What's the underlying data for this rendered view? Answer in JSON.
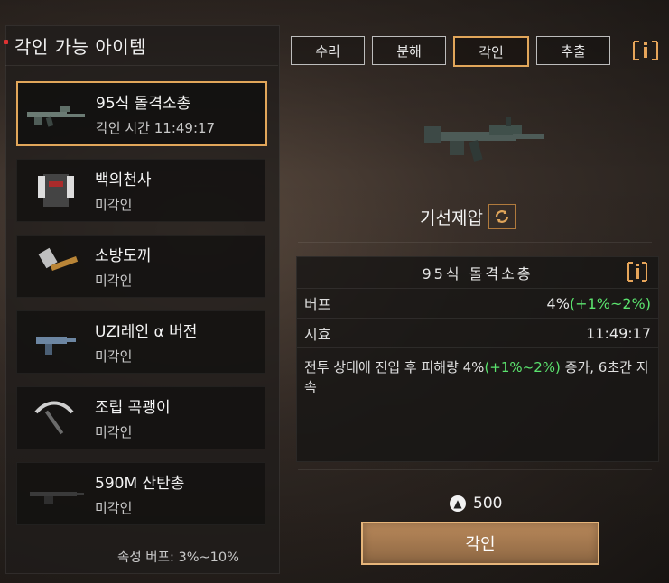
{
  "header": {
    "title": "각인 가능 아이템"
  },
  "left": {
    "items": [
      {
        "name": "95식 돌격소총",
        "sub": "각인 시간 11:49:17",
        "icon": "rifle-icon",
        "selected": true
      },
      {
        "name": "백의천사",
        "sub": "미각인",
        "icon": "vest-icon",
        "selected": false
      },
      {
        "name": "소방도끼",
        "sub": "미각인",
        "icon": "axe-icon",
        "selected": false
      },
      {
        "name": "UZI레인 α 버전",
        "sub": "미각인",
        "icon": "smg-icon",
        "selected": false
      },
      {
        "name": "조립 곡괭이",
        "sub": "미각인",
        "icon": "pickaxe-icon",
        "selected": false
      },
      {
        "name": "590M 산탄총",
        "sub": "미각인",
        "icon": "shotgun-icon",
        "selected": false
      }
    ],
    "attribute_text": "속성 버프: 3%~10%"
  },
  "tabs": [
    "수리",
    "분해",
    "각인",
    "추출"
  ],
  "active_tab": "각인",
  "engrave": {
    "name": "기선제압"
  },
  "stats": {
    "header": "95식 돌격소총",
    "buff_label": "버프",
    "buff_value": "4%",
    "buff_range": "(+1%~2%)",
    "duration_label": "시효",
    "duration_value": "11:49:17",
    "desc_prefix": "전투 상태에 진입 후 피해량 4%",
    "desc_range": "(+1%~2%)",
    "desc_suffix": " 증가, 6초간 지속"
  },
  "cost": {
    "amount": "500"
  },
  "action": {
    "label": "각인"
  },
  "colors": {
    "accent": "#e1a65a",
    "green": "#5be36e"
  }
}
